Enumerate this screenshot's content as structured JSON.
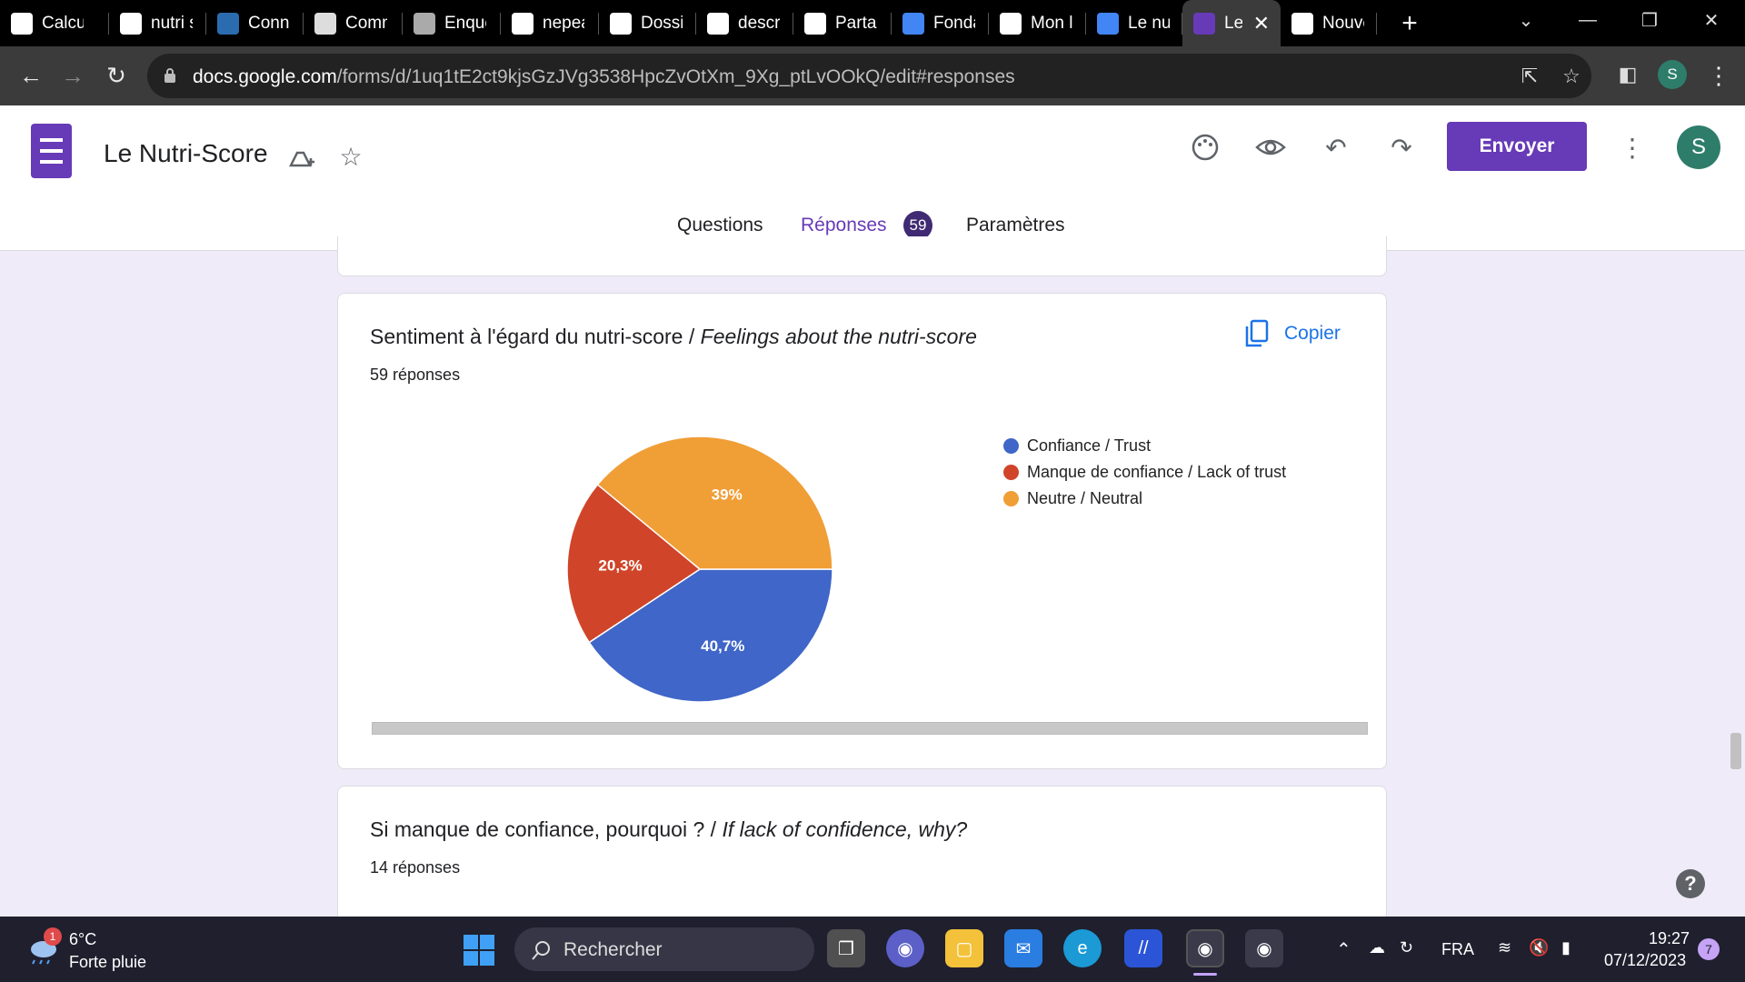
{
  "browser": {
    "tabs": [
      {
        "title": "Calcul",
        "icon": "chatgpt-icon",
        "color": "#ffffff"
      },
      {
        "title": "nutri s",
        "icon": "google-icon",
        "color": "#ffffff"
      },
      {
        "title": "Conna",
        "icon": "e-icon",
        "color": "#2b6cb0"
      },
      {
        "title": "Comm",
        "icon": "doc-thumb-icon",
        "color": "#dddddd"
      },
      {
        "title": "Enquê",
        "icon": "globe-icon",
        "color": "#aaaaaa"
      },
      {
        "title": "nepea",
        "icon": "google-icon",
        "color": "#ffffff"
      },
      {
        "title": "Dossie",
        "icon": "flag-icon",
        "color": "#ffffff"
      },
      {
        "title": "descri",
        "icon": "google-icon",
        "color": "#ffffff"
      },
      {
        "title": "Partag",
        "icon": "drive-icon",
        "color": "#ffffff"
      },
      {
        "title": "Fonda",
        "icon": "docs-icon",
        "color": "#4285f4"
      },
      {
        "title": "Mon l",
        "icon": "drive-icon",
        "color": "#ffffff"
      },
      {
        "title": "Le nut",
        "icon": "docs-icon",
        "color": "#4285f4"
      },
      {
        "title": "Le",
        "icon": "forms-icon",
        "color": "#673ab7",
        "active": true
      },
      {
        "title": "Nouve",
        "icon": "chrome-icon",
        "color": "#ffffff"
      }
    ],
    "url_domain": "docs.google.com",
    "url_path": "/forms/d/1uq1tE2ct9kjsGzJVg3538HpcZvOtXm_9Xg_ptLvOOkQ/edit#responses",
    "profile_initial": "S"
  },
  "form": {
    "title": "Le Nutri-Score",
    "send_label": "Envoyer",
    "avatar_initial": "S",
    "tabs": {
      "questions": "Questions",
      "responses": "Réponses",
      "responses_count": "59",
      "settings": "Paramètres"
    }
  },
  "question1": {
    "title_fr": "Sentiment à l'égard du nutri-score / ",
    "title_en": "Feelings about the nutri-score",
    "responses": "59 réponses",
    "copy_label": "Copier"
  },
  "question2": {
    "title_fr": "Si manque de confiance, pourquoi ? / ",
    "title_en": "If lack of confidence, why?",
    "responses": "14 réponses"
  },
  "chart_data": {
    "type": "pie",
    "slices": [
      {
        "label": "Confiance / Trust",
        "value": 40.7,
        "display": "40,7%",
        "color": "#3f66c8"
      },
      {
        "label": "Manque de confiance / Lack of trust",
        "value": 20.3,
        "display": "20,3%",
        "color": "#d0452a"
      },
      {
        "label": "Neutre / Neutral",
        "value": 39.0,
        "display": "39%",
        "color": "#f09e36"
      }
    ],
    "legend_position": "right"
  },
  "taskbar": {
    "weather_temp": "6°C",
    "weather_desc": "Forte pluie",
    "weather_badge": "1",
    "search_placeholder": "Rechercher",
    "language": "FRA",
    "time": "19:27",
    "date": "07/12/2023",
    "notif_count": "7"
  }
}
